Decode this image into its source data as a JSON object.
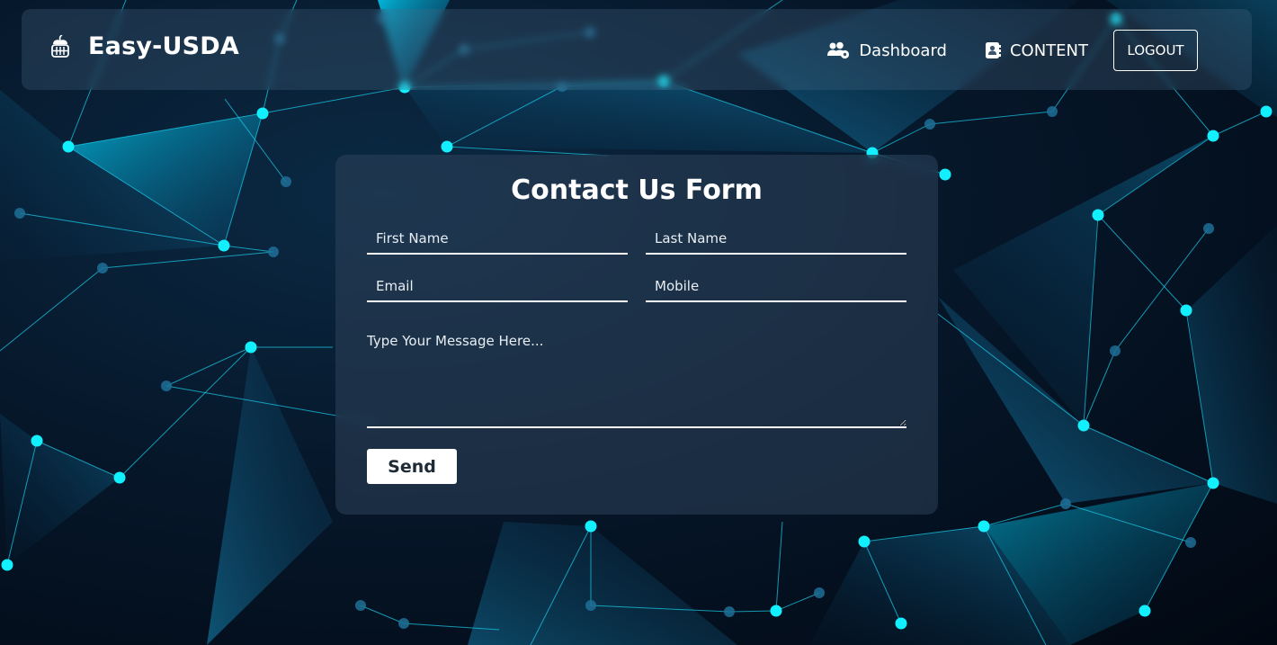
{
  "navbar": {
    "brand_name": "Easy-USDA",
    "brand_icon": "basket-apple-icon",
    "links": [
      {
        "label": "Dashboard",
        "icon": "users-gear-icon"
      },
      {
        "label": "CONTENT",
        "icon": "address-book-icon"
      }
    ],
    "logout_label": "LOGOUT"
  },
  "form": {
    "title": "Contact Us Form",
    "first_name_placeholder": "First Name",
    "last_name_placeholder": "Last Name",
    "email_placeholder": "Email",
    "mobile_placeholder": "Mobile",
    "message_placeholder": "Type Your Message Here...",
    "send_label": "Send"
  },
  "colors": {
    "accent": "#00e5ff",
    "background": "#06172a",
    "card": "#2d415a",
    "text": "#ffffff"
  }
}
